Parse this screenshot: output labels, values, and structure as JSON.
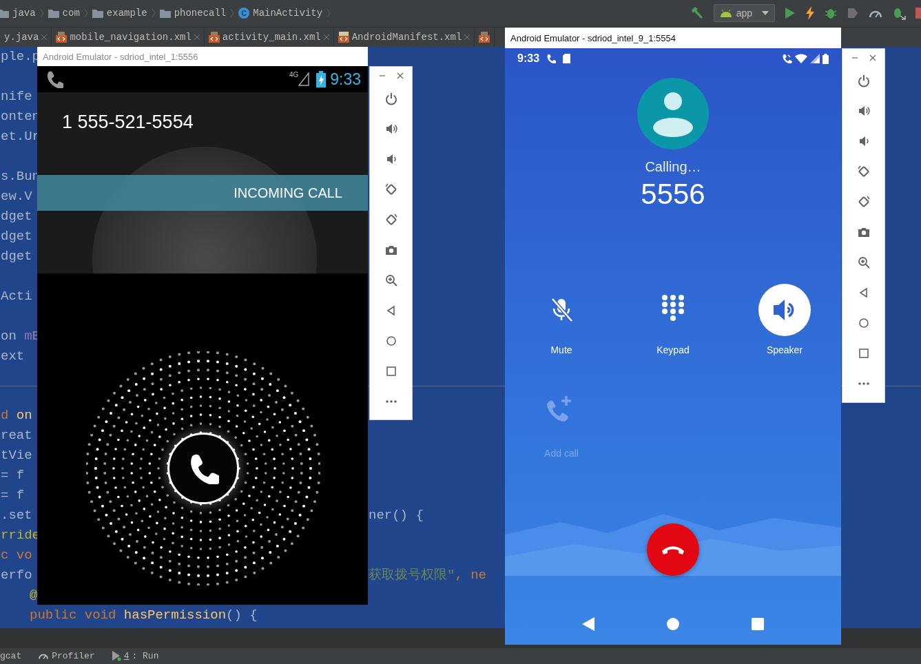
{
  "ide": {
    "breadcrumbs": [
      {
        "label": "java",
        "kind": "folder"
      },
      {
        "label": "com",
        "kind": "folder"
      },
      {
        "label": "example",
        "kind": "folder"
      },
      {
        "label": "phonecall",
        "kind": "folder"
      },
      {
        "label": "MainActivity",
        "kind": "class",
        "badge": "C"
      }
    ],
    "run_config": "app",
    "tabs": [
      {
        "label": "y.java",
        "kind": "java"
      },
      {
        "label": "mobile_navigation.xml",
        "kind": "xml"
      },
      {
        "label": "activity_main.xml",
        "kind": "xml"
      },
      {
        "label": "AndroidManifest.xml",
        "kind": "manifest"
      },
      {
        "kind": "xml"
      }
    ],
    "code_blocks": [
      {
        "kind": "imports",
        "lines": [
          {
            "segments": [
              {
                "text": "ple.p",
                "kind": "plain"
              }
            ]
          }
        ]
      },
      {
        "kind": "imports",
        "lines": [
          {
            "segments": [
              {
                "text": "nife",
                "kind": "plain"
              }
            ]
          },
          {
            "segments": [
              {
                "text": "onten",
                "kind": "plain"
              }
            ]
          },
          {
            "segments": [
              {
                "text": "et.Ur",
                "kind": "plain"
              }
            ]
          }
        ]
      },
      {
        "kind": "imports",
        "lines": [
          {
            "segments": [
              {
                "text": "s.Bun",
                "kind": "plain"
              }
            ]
          },
          {
            "segments": [
              {
                "text": "ew.V",
                "kind": "plain"
              }
            ]
          },
          {
            "segments": [
              {
                "text": "dget",
                "kind": "plain"
              }
            ]
          },
          {
            "segments": [
              {
                "text": "dget",
                "kind": "plain"
              }
            ]
          },
          {
            "segments": [
              {
                "text": "dget",
                "kind": "plain"
              }
            ]
          }
        ]
      },
      {
        "kind": "imports",
        "lines": [
          {
            "segments": [
              {
                "text": "Acti",
                "kind": "plain"
              }
            ]
          }
        ]
      },
      {
        "kind": "imports",
        "lines": [
          {
            "segments": [
              {
                "text": "on ",
                "kind": "plain"
              },
              {
                "text": "mB",
                "kind": "field"
              }
            ]
          },
          {
            "segments": [
              {
                "text": "ext",
                "kind": "plain"
              }
            ]
          }
        ]
      },
      {
        "kind": "method",
        "lines": [
          {
            "segments": [
              {
                "text": "d ",
                "kind": "keyword"
              },
              {
                "text": "on",
                "kind": "method"
              }
            ]
          },
          {
            "segments": [
              {
                "text": "reat",
                "kind": "plain"
              }
            ]
          },
          {
            "segments": [
              {
                "text": "tVie",
                "kind": "plain"
              }
            ]
          },
          {
            "segments": [
              {
                "text": "= f",
                "kind": "plain"
              }
            ]
          },
          {
            "segments": [
              {
                "text": "= f",
                "kind": "plain"
              }
            ]
          },
          {
            "segments": [
              {
                "text": ".set",
                "kind": "plain"
              }
            ],
            "right": [
              {
                "text": "ner() {",
                "kind": "plain"
              }
            ]
          },
          {
            "segments": [
              {
                "text": "rride",
                "kind": "annotation"
              }
            ]
          },
          {
            "segments": [
              {
                "text": "c vo",
                "kind": "keyword"
              }
            ]
          },
          {
            "segments": [
              {
                "text": "erfo",
                "kind": "plain"
              }
            ],
            "right": [
              {
                "text": "获取拨号权限\"",
                "kind": "string"
              },
              {
                "text": ", ne",
                "kind": "keyword"
              }
            ]
          },
          {
            "kind": "nested",
            "segments": [
              {
                "text": "@",
                "kind": "annotation"
              }
            ]
          },
          {
            "kind": "nested",
            "segments": [
              {
                "text": "public void ",
                "kind": "keyword"
              },
              {
                "text": "hasPermission",
                "kind": "method"
              },
              {
                "text": "() {",
                "kind": "plain"
              }
            ]
          }
        ]
      }
    ],
    "tool_windows": [
      {
        "label": "gcat",
        "kind": "plain"
      },
      {
        "label": "Profiler",
        "kind": "profiler"
      },
      {
        "mnemonic": "4",
        "label": ": Run",
        "kind": "run"
      }
    ]
  },
  "emulators": [
    {
      "kind": "incoming",
      "title": "Android Emulator - sdriod_intel_1:5556",
      "screen": {
        "time": "9:33",
        "network": "4G",
        "number": "1 555-521-5554",
        "banner": "INCOMING CALL"
      }
    },
    {
      "kind": "outgoing",
      "title": "Android Emulator - sdriod_intel_9_1:5554",
      "screen": {
        "time": "9:33",
        "status": "Calling…",
        "number": "5556",
        "actions": [
          {
            "kind": "mute",
            "label": "Mute",
            "on": false,
            "disabled": false
          },
          {
            "kind": "keypad",
            "label": "Keypad",
            "on": false,
            "disabled": false
          },
          {
            "kind": "speaker",
            "label": "Speaker",
            "on": true,
            "disabled": false
          },
          {
            "kind": "add-call",
            "label": "Add call",
            "on": false,
            "disabled": true
          }
        ]
      }
    }
  ]
}
